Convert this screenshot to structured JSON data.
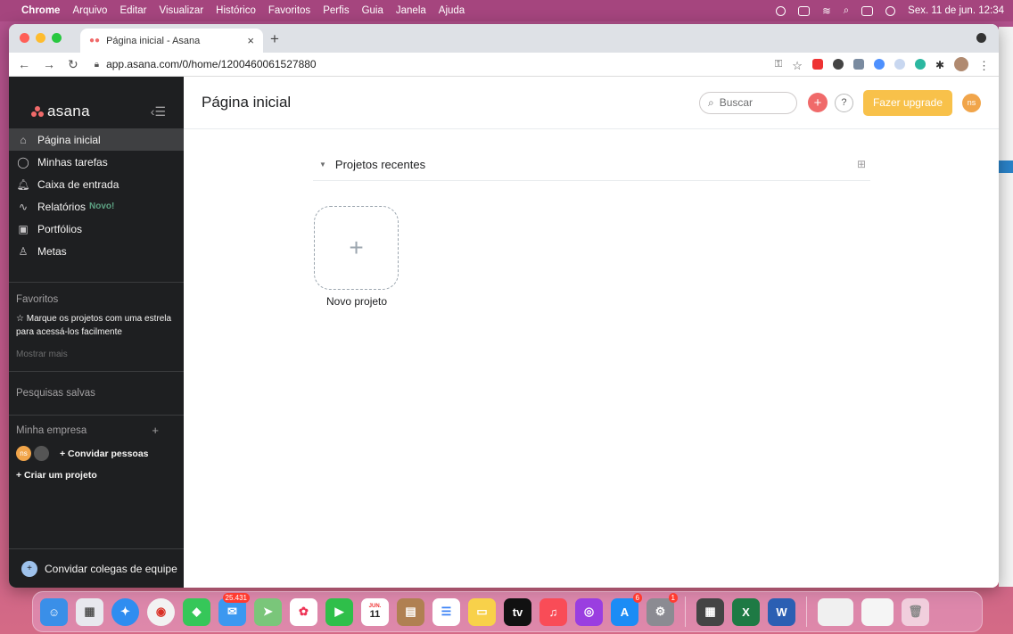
{
  "menubar": {
    "app_name": "Chrome",
    "items": [
      "Arquivo",
      "Editar",
      "Visualizar",
      "Histórico",
      "Favoritos",
      "Perfis",
      "Guia",
      "Janela",
      "Ajuda"
    ],
    "clock": "Sex. 11 de jun.  12:34"
  },
  "browser": {
    "tab_title": "Página inicial - Asana",
    "url": "app.asana.com/0/home/1200460061527880"
  },
  "sidebar": {
    "logo": "asana",
    "nav": [
      {
        "label": "Página inicial",
        "icon": "home-icon"
      },
      {
        "label": "Minhas tarefas",
        "icon": "check-circle-icon"
      },
      {
        "label": "Caixa de entrada",
        "icon": "bell-icon"
      },
      {
        "label": "Relatórios",
        "icon": "chart-line-icon",
        "badge": "Novo!"
      },
      {
        "label": "Portfólios",
        "icon": "portfolio-icon"
      },
      {
        "label": "Metas",
        "icon": "person-icon"
      }
    ],
    "favorites_title": "Favoritos",
    "favorites_hint": "☆ Marque os projetos com uma estrela para acessá-los facilmente",
    "show_more": "Mostrar mais",
    "saved_searches": "Pesquisas salvas",
    "team_title": "Minha empresa",
    "team_add": "+",
    "avatar_initials": "ns",
    "invite_people": "+ Convidar pessoas",
    "create_project": "+ Criar um projeto",
    "invite_colleagues": "Convidar colegas de equipe"
  },
  "main": {
    "page_title": "Página inicial",
    "search_placeholder": "Buscar",
    "help": "?",
    "upgrade": "Fazer upgrade",
    "user_initials": "ns",
    "recent_title": "Projetos recentes",
    "new_project": "Novo projeto",
    "new_project_plus": "+"
  },
  "dock": {
    "mail_badge": "25.431",
    "calendar_month": "JUN.",
    "calendar_day": "11",
    "appstore_badge": "6",
    "settings_badge": "1"
  },
  "colors": {
    "sidebar_bg": "#1e1f21",
    "upgrade": "#f8c14a",
    "asana_coral": "#f06a6a"
  }
}
